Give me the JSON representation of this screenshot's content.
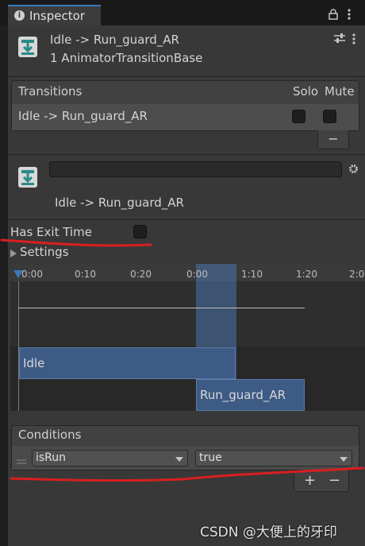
{
  "tab": {
    "title": "Inspector",
    "lock_icon": "lock-icon",
    "menu_icon": "kebab-menu-icon"
  },
  "header": {
    "title": "Idle -> Run_guard_AR",
    "subtitle": "1 AnimatorTransitionBase",
    "icon": "transition-icon",
    "settings_icon": "preset-sliders-icon",
    "menu_icon": "kebab-menu-icon"
  },
  "transitions": {
    "header_label": "Transitions",
    "solo_label": "Solo",
    "mute_label": "Mute",
    "rows": [
      {
        "label": "Idle -> Run_guard_AR",
        "solo": false,
        "mute": false
      }
    ],
    "remove_label": "−"
  },
  "transition_detail": {
    "name_value": "",
    "label": "Idle -> Run_guard_AR",
    "icon": "transition-icon",
    "gear_icon": "gear-icon"
  },
  "settings": {
    "has_exit_time_label": "Has Exit Time",
    "has_exit_time_checked": false,
    "settings_label": "Settings"
  },
  "timeline": {
    "ticks": [
      "0:00",
      "0:10",
      "0:20",
      "0:00",
      "1:10",
      "1:20",
      "2:0"
    ],
    "source_state": "Idle",
    "dest_state": "Run_guard_AR"
  },
  "conditions": {
    "header_label": "Conditions",
    "rows": [
      {
        "parameter": "isRun",
        "value": "true"
      }
    ],
    "add_label": "+",
    "remove_label": "−"
  },
  "watermark": {
    "text": "CSDN @大便上的牙印"
  },
  "colors": {
    "accent": "#3a79bb",
    "annotation": "#d81f1f",
    "bar": "#3e5b86"
  }
}
